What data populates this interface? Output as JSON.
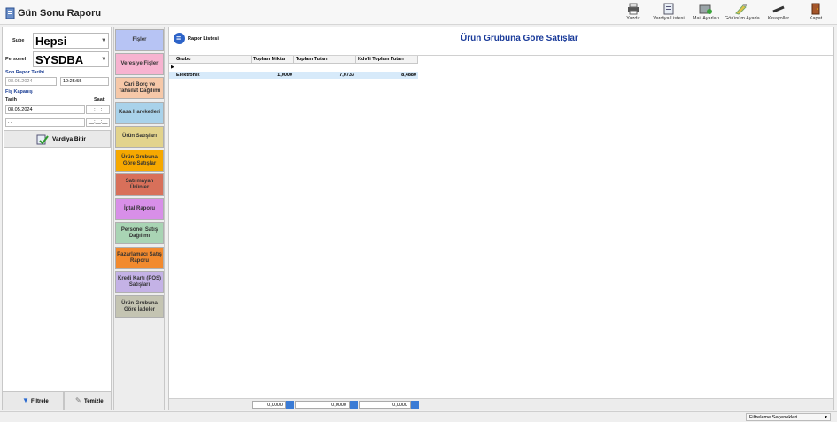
{
  "window": {
    "title": "Gün Sonu Raporu"
  },
  "toolbar": {
    "items": [
      {
        "label": "Yazdır"
      },
      {
        "label": "Vardiya Listesi"
      },
      {
        "label": "Mail Ayarları"
      },
      {
        "label": "Görünüm Ayarla"
      },
      {
        "label": "Kısayollar"
      },
      {
        "label": "Kapat"
      }
    ]
  },
  "filters": {
    "sube_label": "Şube",
    "sube_value": "Hepsi",
    "personel_label": "Personel",
    "personel_value": "SYSDBA",
    "son_rapor_label": "Son Rapor Tarihi",
    "son_rapor_date": "08.05.2024",
    "son_rapor_time": "10:25:55",
    "fis_kapanis_label": "Fiş Kapanış",
    "tarih_label": "Tarih",
    "saat_label": "Saat",
    "tarih_from": "08.05.2024",
    "saat_from": "__:__:__",
    "tarih_to": " . .",
    "saat_to": "__:__:__",
    "vardiya_bitir": "Vardiya Bitir",
    "filtrele": "Filtrele",
    "temizle": "Temizle"
  },
  "menu": {
    "items": [
      {
        "label": "Fişler",
        "color": "#b7c4f4"
      },
      {
        "label": "Veresiye Fişler",
        "color": "#f7b3d0"
      },
      {
        "label": "Cari Borç ve Tahsilat Dağılımı",
        "color": "#f6c8a8"
      },
      {
        "label": "Kasa Hareketleri",
        "color": "#a9d2ea"
      },
      {
        "label": "Ürün Satışları",
        "color": "#e2d38c"
      },
      {
        "label": "Ürün Grubuna Göre Satışlar",
        "color": "#f6a800"
      },
      {
        "label": "Satılmayan Ürünler",
        "color": "#d8705a"
      },
      {
        "label": "İptal Raporu",
        "color": "#d88fe8"
      },
      {
        "label": "Personel Satış Dağılımı",
        "color": "#a9d4b4"
      },
      {
        "label": "Pazarlamacı Satış Raporu",
        "color": "#f28a2e"
      },
      {
        "label": "Kredi Kartı (POS) Satışları",
        "color": "#c4b2e6"
      },
      {
        "label": "Ürün Grubuna Göre İadeler",
        "color": "#c4c4b2"
      }
    ]
  },
  "report": {
    "list_label": "Rapor Listesi",
    "title": "Ürün Grubuna Göre Satışlar",
    "columns": [
      "Grubu",
      "Toplam Miktar",
      "Toplam Tutarı",
      "Kdv'li Toplam Tutarı"
    ],
    "rows": [
      {
        "grubu": "Elektronik",
        "miktar": "1,0000",
        "tutar": "7,0733",
        "kdv": "8,4880"
      }
    ],
    "totals": [
      "0,0000",
      "0,0000",
      "0,0000"
    ]
  },
  "status": {
    "filter_options": "Filtreleme Seçenekleri"
  }
}
